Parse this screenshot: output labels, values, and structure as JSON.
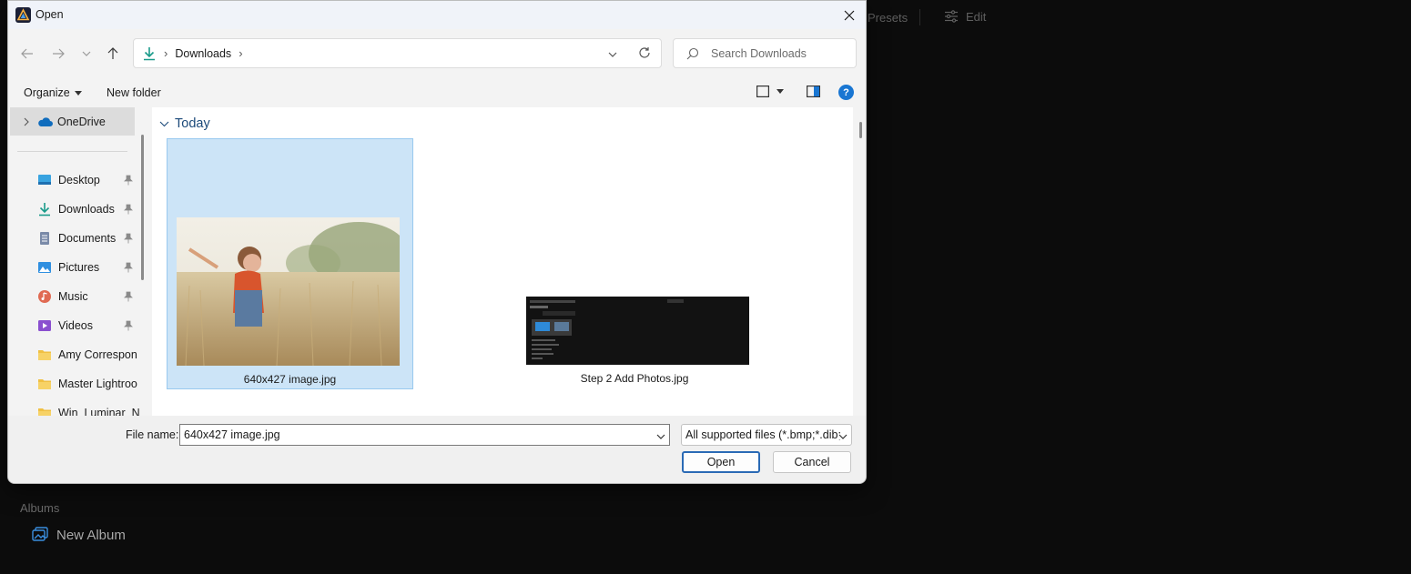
{
  "background_app": {
    "tabs": {
      "presets_label": "Presets",
      "edit_label": "Edit"
    },
    "albums": {
      "section_label": "Albums",
      "new_album_label": "New Album"
    }
  },
  "dialog": {
    "title": "Open",
    "address": {
      "location": "Downloads"
    },
    "search": {
      "placeholder": "Search Downloads"
    },
    "commands": {
      "organize_label": "Organize",
      "new_folder_label": "New folder",
      "help_label": "?"
    },
    "sidebar": {
      "onedrive_label": "OneDrive",
      "items": [
        {
          "label": "Desktop",
          "icon": "desktop-icon",
          "pinned": true
        },
        {
          "label": "Downloads",
          "icon": "download-icon",
          "pinned": true
        },
        {
          "label": "Documents",
          "icon": "document-icon",
          "pinned": true
        },
        {
          "label": "Pictures",
          "icon": "pictures-icon",
          "pinned": true
        },
        {
          "label": "Music",
          "icon": "music-icon",
          "pinned": true
        },
        {
          "label": "Videos",
          "icon": "video-icon",
          "pinned": true
        },
        {
          "label": "Amy Correspon",
          "icon": "folder-icon",
          "pinned": false
        },
        {
          "label": "Master Lightroo",
          "icon": "folder-icon",
          "pinned": false
        },
        {
          "label": "Win_Luminar_N",
          "icon": "folder-icon",
          "pinned": false
        }
      ]
    },
    "content": {
      "group_label": "Today",
      "files": [
        {
          "name": "640x427 image.jpg",
          "selected": true
        },
        {
          "name": "Step 2 Add Photos.jpg",
          "selected": false
        }
      ]
    },
    "footer": {
      "file_name_label": "File name:",
      "file_name_value": "640x427 image.jpg",
      "file_type_value": "All supported files (*.bmp;*.dib;",
      "open_label": "Open",
      "cancel_label": "Cancel"
    }
  },
  "colors": {
    "accent": "#1976d2",
    "selection": "#cce4f7",
    "group_header": "#1c4a7a"
  }
}
